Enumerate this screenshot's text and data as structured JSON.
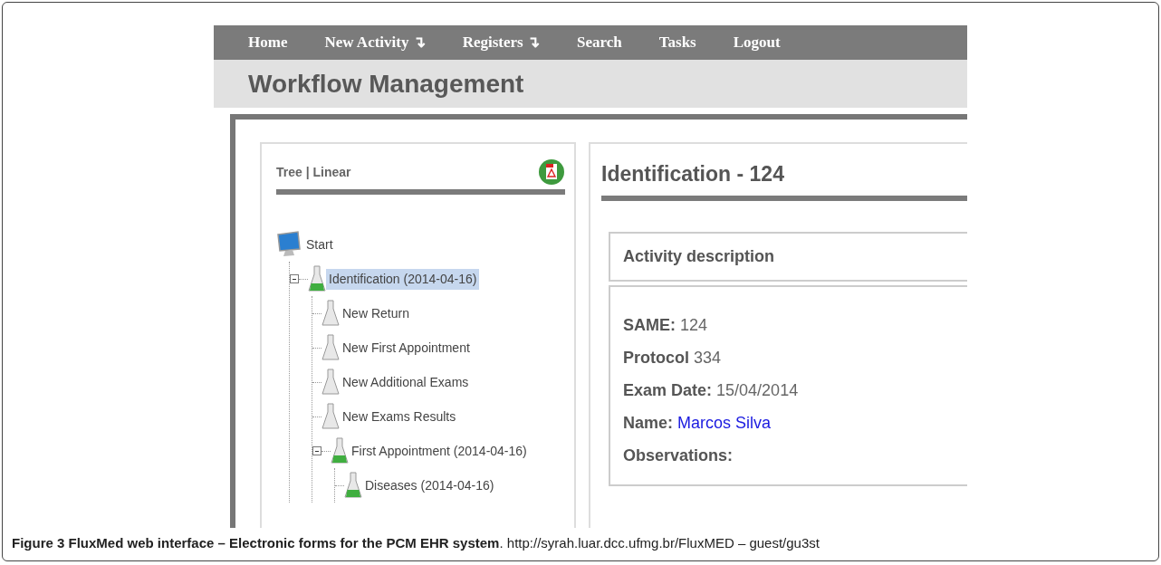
{
  "nav": {
    "items": [
      {
        "label": "Home"
      },
      {
        "label": "New Activity",
        "arrow": "↴"
      },
      {
        "label": "Registers",
        "arrow": "↴"
      },
      {
        "label": "Search"
      },
      {
        "label": "Tasks"
      },
      {
        "label": "Logout"
      }
    ]
  },
  "header": {
    "title": "Workflow Management"
  },
  "tree_panel": {
    "title": "Tree | Linear",
    "root": {
      "label": "Start",
      "kind": "computer",
      "children": [
        {
          "label": "Identification (2014-04-16)",
          "kind": "flask",
          "done": true,
          "selected": true,
          "expanded": true,
          "children": [
            {
              "label": "New Return",
              "kind": "flask",
              "done": false,
              "selected": false
            },
            {
              "label": "New First Appointment",
              "kind": "flask",
              "done": false,
              "selected": false
            },
            {
              "label": "New Additional Exams",
              "kind": "flask",
              "done": false,
              "selected": false
            },
            {
              "label": "New Exams Results",
              "kind": "flask",
              "done": false,
              "selected": false
            },
            {
              "label": "First Appointment (2014-04-16)",
              "kind": "flask",
              "done": true,
              "selected": false,
              "expanded": true,
              "children": [
                {
                  "label": "Diseases (2014-04-16)",
                  "kind": "flask",
                  "done": true,
                  "selected": false
                }
              ]
            }
          ]
        }
      ]
    }
  },
  "detail": {
    "title": "Identification - 124",
    "section": "Activity description",
    "fields": [
      {
        "label": "SAME:",
        "value": "124",
        "kind": "text"
      },
      {
        "label": "Protocol",
        "value": "334",
        "kind": "text"
      },
      {
        "label": "Exam Date:",
        "value": "15/04/2014",
        "kind": "text"
      },
      {
        "label": "Name:",
        "value": "Marcos Silva",
        "kind": "link"
      },
      {
        "label": "Observations:"
      }
    ]
  },
  "caption": "**Figure 3 FluxMed web interface – Electronic forms for the PCM EHR system**. http://syrah.luar.dcc.ufmg.br/FluxMED – guest/gu3st"
}
